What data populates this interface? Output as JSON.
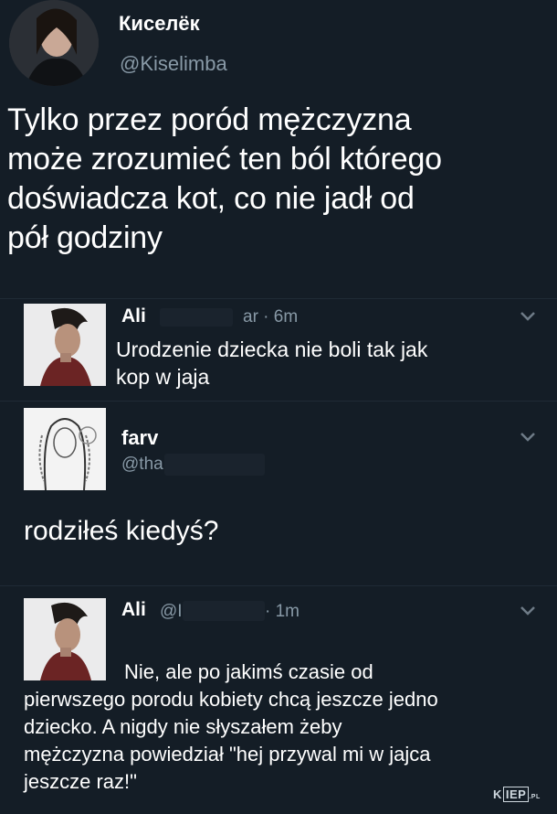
{
  "main_tweet": {
    "author_name": "Киселёк",
    "author_handle": "@Kiselimba",
    "text_lines": [
      "Tylko przez poród mężczyzna",
      "może zrozumieć ten ból którego",
      "doświadcza kot, co nie jadł od",
      "pół godziny"
    ]
  },
  "reply1": {
    "author_name": "Ali",
    "meta": "ar · 6m",
    "text_lines": [
      "Urodzenie dziecka nie boli tak jak",
      "kop w jaja"
    ]
  },
  "reply2": {
    "author_name": "farv",
    "author_handle": "@tha",
    "text": "rodziłeś kiedyś?"
  },
  "reply3": {
    "author_name": "Ali",
    "author_handle": "@I",
    "meta": "· 1m",
    "text_lines": [
      "Nie, ale po jakimś czasie od",
      "pierwszego porodu kobiety chcą jeszcze jedno",
      "dziecko. A nigdy nie słyszałem żeby",
      "mężczyzna powiedział \"hej przywal mi w jajca",
      "jeszcze raz!\""
    ]
  },
  "watermark": {
    "part1": "K",
    "part2": "IEP",
    "suffix": ".PL"
  },
  "colors": {
    "background": "#141d26",
    "text": "#ffffff",
    "muted": "#8899a6"
  },
  "icons": [
    "chevron-down-icon"
  ]
}
